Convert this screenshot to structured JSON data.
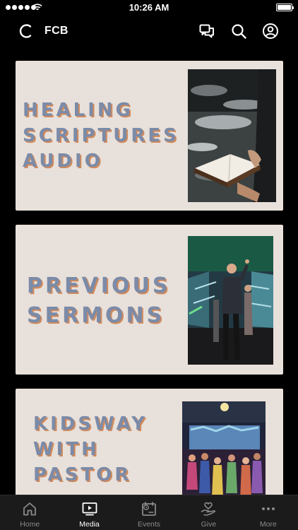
{
  "status_bar": {
    "time": "10:26 AM"
  },
  "header": {
    "title": "FCB",
    "icons": [
      "loading-logo-icon",
      "chat-icon",
      "search-icon",
      "profile-icon"
    ]
  },
  "cards": [
    {
      "title_lines": [
        "HEALING",
        "SCRIPTURES",
        "AUDIO"
      ],
      "photo": "person holding open bible by water"
    },
    {
      "title_lines": [
        "PREVIOUS",
        "SERMONS"
      ],
      "photo": "pastor preaching on stage"
    },
    {
      "title_lines": [
        "KIDSWAY",
        "WITH",
        "PASTOR"
      ],
      "photo": "kids worship room with lights"
    }
  ],
  "tab_bar": {
    "active": "Media",
    "tabs": [
      {
        "label": "Home",
        "icon": "home-icon"
      },
      {
        "label": "Media",
        "icon": "media-icon"
      },
      {
        "label": "Events",
        "icon": "events-icon"
      },
      {
        "label": "Give",
        "icon": "give-icon"
      },
      {
        "label": "More",
        "icon": "more-icon"
      }
    ]
  },
  "colors": {
    "card_bg": "#e8e0da",
    "title_text": "#7b8ba8",
    "title_shadow": "#d08a5c",
    "tab_bar_bg": "#1b1b1b"
  }
}
